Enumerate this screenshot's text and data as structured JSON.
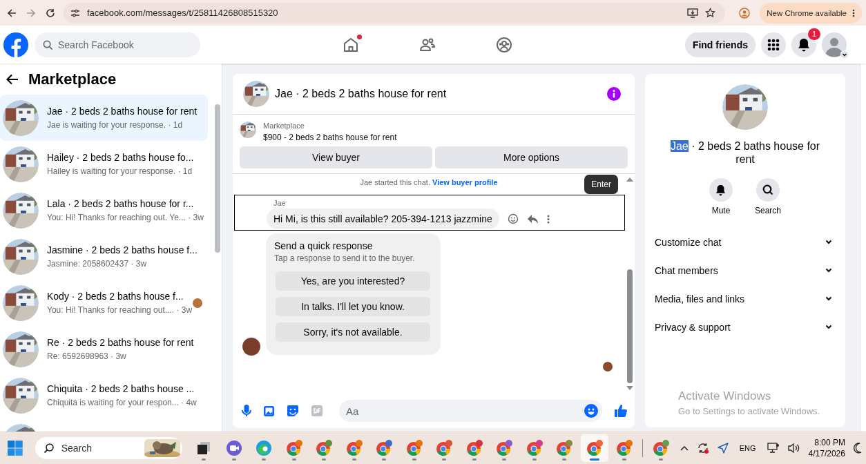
{
  "browser": {
    "url": "facebook.com/messages/t/25811426808515320",
    "update_label": "New Chrome available"
  },
  "header": {
    "search_placeholder": "Search Facebook",
    "home_notification": true,
    "find_friends": "Find friends",
    "notification_count": "1"
  },
  "sidebar": {
    "title": "Marketplace",
    "items": [
      {
        "title": "Jae · 2 beds 2 baths house for rent",
        "preview": "Jae is waiting for your response. · 1d",
        "selected": true,
        "seen": false
      },
      {
        "title": "Hailey · 2 beds 2 baths house fo...",
        "preview": "Hailey is waiting for your response. · 1d",
        "selected": false,
        "seen": false
      },
      {
        "title": "Lala · 2 beds 2 baths house for r...",
        "preview": "You: Hi! Thanks for reaching out. Ye... · 3w",
        "selected": false,
        "seen": false
      },
      {
        "title": "Jasmine · 2 beds 2 baths house f...",
        "preview": "Jasmine: 2058602437 · 3w",
        "selected": false,
        "seen": false
      },
      {
        "title": "Kody · 2 beds 2 baths house f...",
        "preview": "You: Hi! Thanks for reaching out.... · 3w",
        "selected": false,
        "seen": true
      },
      {
        "title": "Re · 2 beds 2 baths house for rent",
        "preview": "Re: 6592698963 · 3w",
        "selected": false,
        "seen": false
      },
      {
        "title": "Chiquita · 2 beds 2 baths house ...",
        "preview": "Chiquita is waiting for your respon... · 4w",
        "selected": false,
        "seen": false
      }
    ]
  },
  "chat": {
    "title": "Jae · 2 beds 2 baths house for rent",
    "listing_label": "Marketplace",
    "listing": "$900 - 2 beds 2 baths house for rent",
    "buttons": [
      "View buyer",
      "More options"
    ],
    "system_text": "Jae started this chat.",
    "system_link": "View buyer profile",
    "tooltip": "Enter",
    "message": {
      "sender": "Jae",
      "text": "Hi Mi, is this still available? 205-394-1213 jazzmine"
    },
    "quick": {
      "title": "Send a quick response",
      "hint": "Tap a response to send it to the buyer.",
      "options": [
        "Yes, are you interested?",
        "In talks. I'll let you know.",
        "Sorry, it's not available."
      ]
    },
    "composer_placeholder": "Aa"
  },
  "details": {
    "title_parts": [
      {
        "text": "Jae",
        "selected": true
      },
      {
        "text": " · 2 beds 2 baths house for rent",
        "selected": false
      }
    ],
    "actions": [
      {
        "kind": "mute",
        "label": "Mute"
      },
      {
        "kind": "search",
        "label": "Search"
      }
    ],
    "sections": [
      {
        "label": "Customize chat",
        "expanded": false
      },
      {
        "label": "Chat members",
        "expanded": false
      },
      {
        "label": "Media, files and links",
        "expanded": false
      },
      {
        "label": "Privacy & support",
        "expanded": false
      }
    ]
  },
  "activation": {
    "title": "Activate Windows",
    "hint": "Go to Settings to activate Windows."
  },
  "taskbar": {
    "search_placeholder": "Search",
    "apps": [
      {
        "kind": "task-view",
        "active": false
      },
      {
        "kind": "meet",
        "active": false
      },
      {
        "kind": "edge",
        "active": false
      },
      {
        "kind": "chrome",
        "color": "#e8710a",
        "active": false
      },
      {
        "kind": "chrome",
        "color": "#5f8f3e",
        "active": false
      },
      {
        "kind": "chrome",
        "color": "#e8710a",
        "active": false
      },
      {
        "kind": "chrome",
        "color": "#3b6fc4",
        "active": false
      },
      {
        "kind": "chrome",
        "color": "#e8710a",
        "active": false
      },
      {
        "kind": "chrome",
        "color": "#e0523a",
        "active": false
      },
      {
        "kind": "chrome",
        "color": "#d93040",
        "active": false
      },
      {
        "kind": "chrome",
        "color": "#8a5cc8",
        "active": false
      },
      {
        "kind": "chrome",
        "color": "#d63a8a",
        "active": false
      },
      {
        "kind": "chrome",
        "color": "#8a8a3a",
        "active": false
      },
      {
        "kind": "chrome",
        "color": "#f0643a",
        "active": true
      },
      {
        "kind": "chrome",
        "color": "#e8710a",
        "active": false
      },
      {
        "kind": "chrome",
        "color": "#5f9f4e",
        "active": false
      }
    ],
    "language": "ENG",
    "time": "8:00 PM",
    "date": "4/17/2026"
  }
}
